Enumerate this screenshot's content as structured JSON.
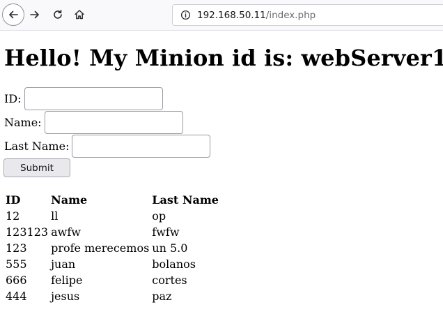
{
  "browser": {
    "url_host": "192.168.50.11",
    "url_path": "/index.php"
  },
  "page": {
    "heading": "Hello! My Minion id is: webServer1",
    "form": {
      "id_label": "ID:",
      "id_value": "",
      "name_label": "Name:",
      "name_value": "",
      "lastname_label": "Last Name:",
      "lastname_value": "",
      "submit_label": "Submit"
    },
    "table": {
      "headers": [
        "ID",
        "Name",
        "Last Name"
      ],
      "rows": [
        [
          "12",
          "ll",
          "op"
        ],
        [
          "123123",
          "awfw",
          "fwfw"
        ],
        [
          "123",
          "profe merecemos",
          "un 5.0"
        ],
        [
          "555",
          "juan",
          "bolanos"
        ],
        [
          "666",
          "felipe",
          "cortes"
        ],
        [
          "444",
          "jesus",
          "paz"
        ]
      ]
    }
  },
  "icons": {
    "back": "back-arrow-icon",
    "forward": "forward-arrow-icon",
    "reload": "reload-icon",
    "home": "home-icon",
    "site_info": "site-info-icon"
  }
}
